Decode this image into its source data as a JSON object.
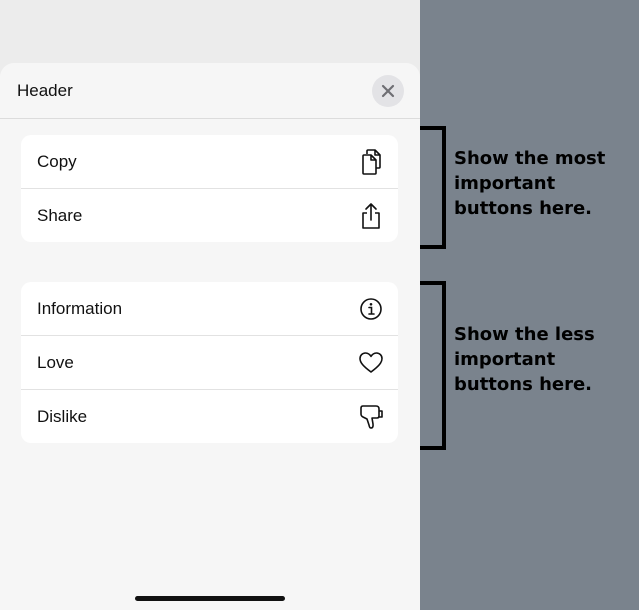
{
  "sheet": {
    "header_title": "Header",
    "close_icon": "close-icon",
    "primary_group": [
      {
        "label": "Copy",
        "icon": "copy-icon"
      },
      {
        "label": "Share",
        "icon": "share-icon"
      }
    ],
    "secondary_group": [
      {
        "label": "Information",
        "icon": "info-icon"
      },
      {
        "label": "Love",
        "icon": "heart-icon"
      },
      {
        "label": "Dislike",
        "icon": "thumbs-down-icon"
      }
    ]
  },
  "annotations": {
    "primary_note": "Show the most important buttons here.",
    "secondary_note": "Show the less important buttons here."
  },
  "colors": {
    "backdrop": "#7a838d",
    "sheet": "#f6f6f6",
    "group": "#ffffff",
    "close_button": "#e3e3e6"
  }
}
